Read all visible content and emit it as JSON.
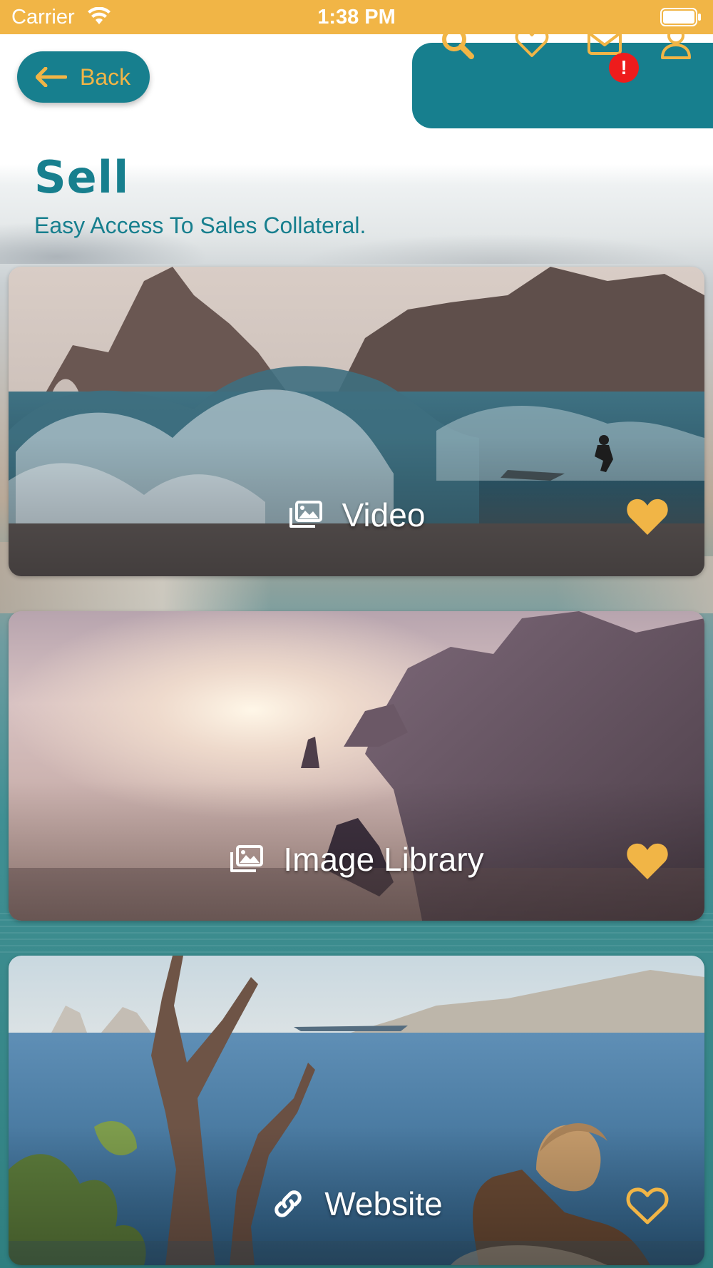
{
  "status_bar": {
    "carrier": "Carrier",
    "time": "1:38 PM"
  },
  "header": {
    "back_label": "Back",
    "nav_icons": [
      "search-icon",
      "heart-outline-icon",
      "mail-icon",
      "user-icon"
    ],
    "notification_badge": "!"
  },
  "page": {
    "title": "Sell",
    "subtitle": "Easy Access To Sales Collateral."
  },
  "cards": [
    {
      "label": "Video",
      "icon": "images-stack-icon",
      "favorited": true
    },
    {
      "label": "Image Library",
      "icon": "images-stack-icon",
      "favorited": true
    },
    {
      "label": "Website",
      "icon": "link-icon",
      "favorited": false
    }
  ],
  "colors": {
    "accent_teal": "#177f8e",
    "accent_gold": "#f1b546",
    "badge_red": "#ee1c1c"
  }
}
